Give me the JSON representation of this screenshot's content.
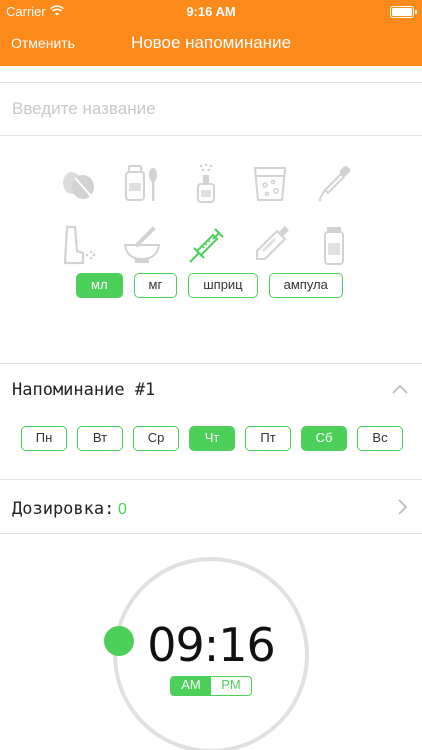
{
  "status_bar": {
    "carrier": "Carrier",
    "time": "9:16 AM"
  },
  "nav": {
    "cancel_label": "Отменить",
    "title": "Новое напоминание"
  },
  "name_field": {
    "placeholder": "Введите название",
    "value": ""
  },
  "medication_types": [
    {
      "icon": "pills-icon",
      "selected": false
    },
    {
      "icon": "syrup-bottle-icon",
      "selected": false
    },
    {
      "icon": "nasal-spray-icon",
      "selected": false
    },
    {
      "icon": "effervescent-glass-icon",
      "selected": false
    },
    {
      "icon": "dropper-icon",
      "selected": false
    },
    {
      "icon": "inhaler-icon",
      "selected": false
    },
    {
      "icon": "mortar-icon",
      "selected": false
    },
    {
      "icon": "syringe-icon",
      "selected": true
    },
    {
      "icon": "ointment-tube-icon",
      "selected": false
    },
    {
      "icon": "vial-icon",
      "selected": false
    }
  ],
  "units": [
    {
      "label": "мл",
      "selected": true
    },
    {
      "label": "мг",
      "selected": false
    },
    {
      "label": "шприц",
      "selected": false
    },
    {
      "label": "ампула",
      "selected": false
    }
  ],
  "reminder": {
    "title": "Напоминание #1",
    "days": [
      {
        "label": "Пн",
        "selected": false
      },
      {
        "label": "Вт",
        "selected": false
      },
      {
        "label": "Ср",
        "selected": false
      },
      {
        "label": "Чт",
        "selected": true
      },
      {
        "label": "Пт",
        "selected": false
      },
      {
        "label": "Сб",
        "selected": true
      },
      {
        "label": "Вс",
        "selected": false
      }
    ],
    "dosage_label": "Дозировка:",
    "dosage_value": "0",
    "time": "09:16",
    "am_label": "AM",
    "pm_label": "PM",
    "period": "AM"
  },
  "colors": {
    "accent_orange": "#FC8A1B",
    "accent_green": "#4CD05A",
    "icon_gray": "#d9d9d9"
  }
}
